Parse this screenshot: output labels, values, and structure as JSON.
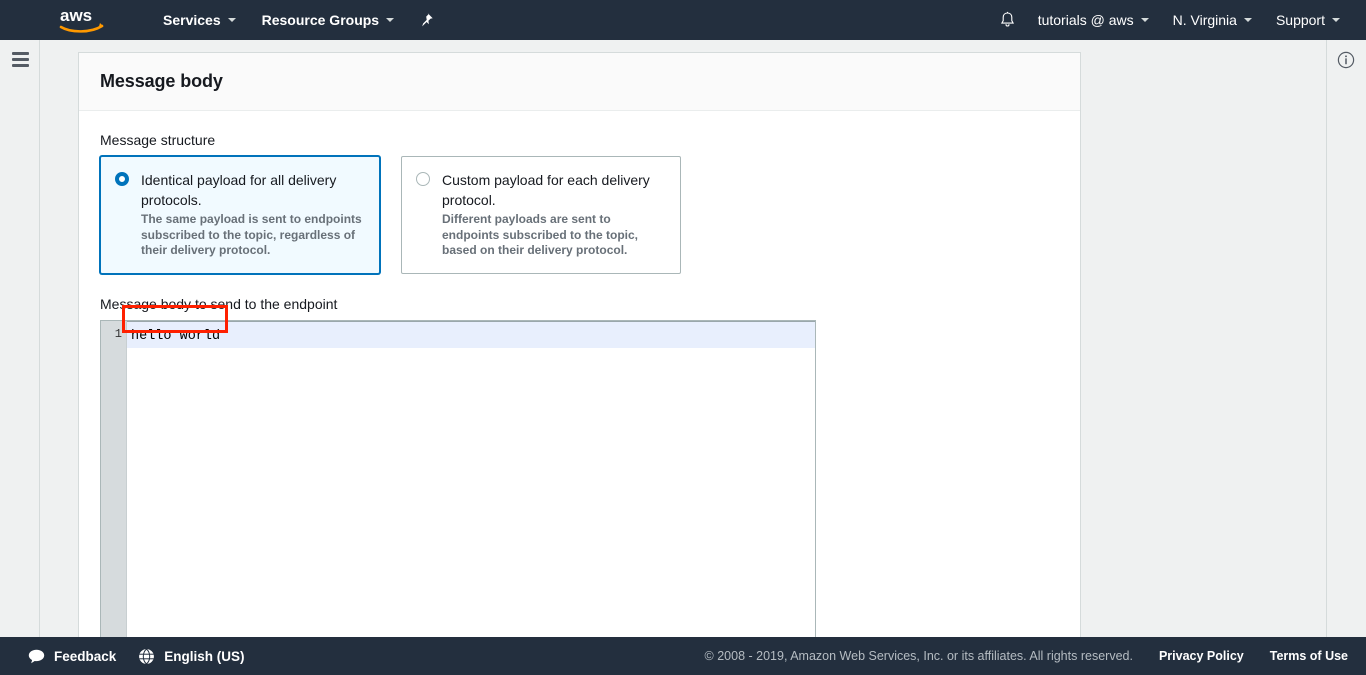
{
  "topnav": {
    "logo_alt": "aws",
    "items": [
      {
        "label": "Services",
        "has_caret": true
      },
      {
        "label": "Resource Groups",
        "has_caret": true
      }
    ],
    "pin_icon": "pushpin-icon",
    "bell_icon": "notifications-bell-icon",
    "right_items": [
      {
        "label": "tutorials @ aws",
        "has_caret": true
      },
      {
        "label": "N. Virginia",
        "has_caret": true
      },
      {
        "label": "Support",
        "has_caret": true
      }
    ]
  },
  "rails": {
    "menu_icon": "hamburger-menu-icon",
    "info_icon": "info-circle-icon"
  },
  "panel": {
    "title": "Message body",
    "structure_label": "Message structure",
    "options": [
      {
        "title": "Identical payload for all delivery protocols.",
        "description": "The same payload is sent to endpoints subscribed to the topic, regardless of their delivery protocol.",
        "selected": true
      },
      {
        "title": "Custom payload for each delivery protocol.",
        "description": "Different payloads are sent to endpoints subscribed to the topic, based on their delivery protocol.",
        "selected": false
      }
    ],
    "body_label": "Message body to send to the endpoint",
    "editor": {
      "line_number": "1",
      "content": "hello world"
    }
  },
  "footer": {
    "feedback_label": "Feedback",
    "feedback_icon": "speech-bubble-icon",
    "language_label": "English (US)",
    "language_icon": "globe-icon",
    "copyright": "© 2008 - 2019, Amazon Web Services, Inc. or its affiliates. All rights reserved.",
    "privacy_label": "Privacy Policy",
    "terms_label": "Terms of Use"
  },
  "colors": {
    "nav_background": "#232f3e",
    "accent_blue": "#0073bb",
    "selected_tile_background": "#f1faff",
    "active_line_background": "#e8effd",
    "gutter": "#d6dbdd",
    "annotation_red": "#ff2000",
    "aws_orange": "#ff9900"
  }
}
